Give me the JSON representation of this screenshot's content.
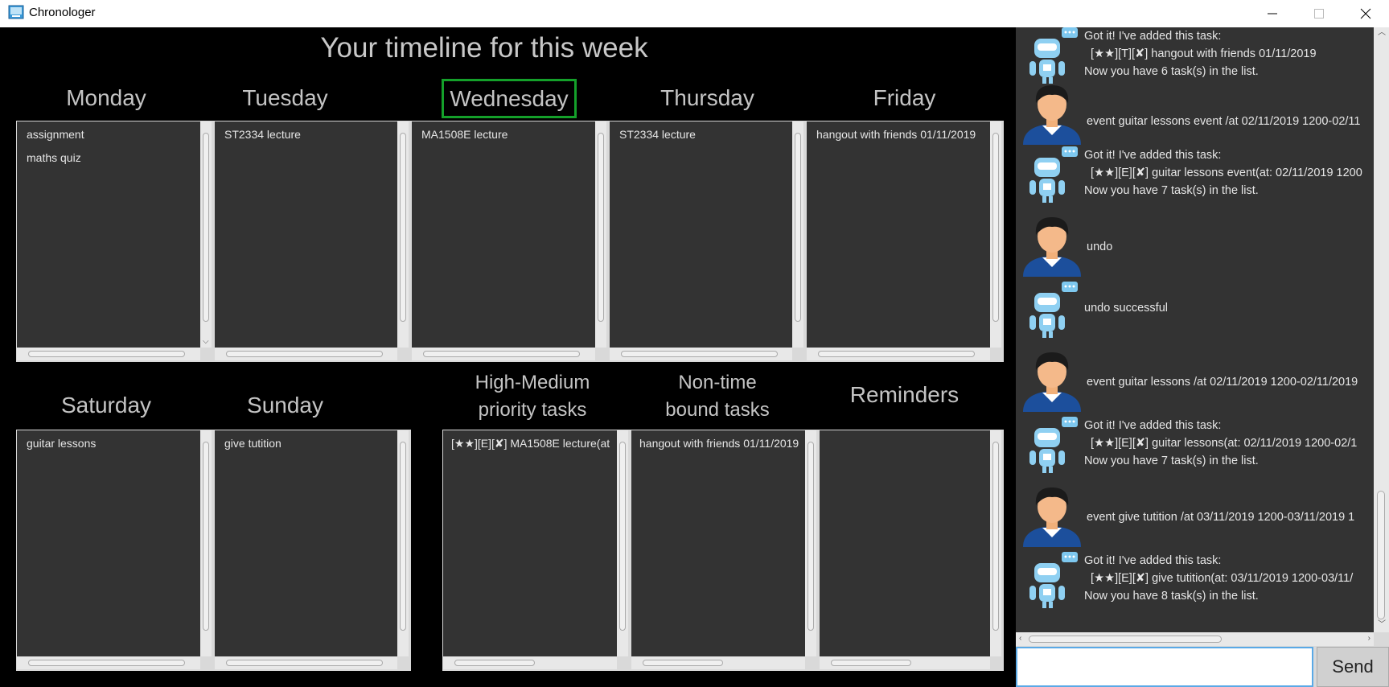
{
  "window": {
    "title": "Chronologer"
  },
  "timeline": {
    "title": "Your timeline for this week"
  },
  "days": [
    {
      "name": "Monday",
      "items": [
        "assignment",
        "maths quiz"
      ]
    },
    {
      "name": "Tuesday",
      "items": [
        "ST2334 lecture"
      ]
    },
    {
      "name": "Wednesday",
      "items": [
        "MA1508E lecture"
      ]
    },
    {
      "name": "Thursday",
      "items": [
        "ST2334 lecture"
      ]
    },
    {
      "name": "Friday",
      "items": [
        "hangout with friends 01/11/2019"
      ]
    },
    {
      "name": "Saturday",
      "items": [
        "guitar lessons"
      ]
    },
    {
      "name": "Sunday",
      "items": [
        "give tutition"
      ]
    }
  ],
  "priority": {
    "label_line1": "High-Medium",
    "label_line2": "priority tasks",
    "items": [
      "[★★][E][✘] MA1508E lecture(at"
    ]
  },
  "nontime": {
    "label_line1": "Non-time",
    "label_line2": "bound tasks",
    "items": [
      "hangout with friends 01/11/2019"
    ]
  },
  "reminders": {
    "label": "Reminders",
    "items": []
  },
  "chat": {
    "messages": [
      {
        "from": "bot",
        "text": "Got it! I've added this task:\n  [★★][T][✘] hangout with friends 01/11/2019\nNow you have 6 task(s) in the list."
      },
      {
        "from": "user",
        "text": "event guitar lessons event /at 02/11/2019 1200-02/11"
      },
      {
        "from": "bot",
        "text": "Got it! I've added this task:\n  [★★][E][✘] guitar lessons event(at: 02/11/2019 1200\nNow you have 7 task(s) in the list."
      },
      {
        "from": "user",
        "text": "undo"
      },
      {
        "from": "bot",
        "text": "undo successful"
      },
      {
        "from": "user",
        "text": "event guitar lessons /at 02/11/2019 1200-02/11/2019"
      },
      {
        "from": "bot",
        "text": "Got it! I've added this task:\n  [★★][E][✘] guitar lessons(at: 02/11/2019 1200-02/1\nNow you have 7 task(s) in the list."
      },
      {
        "from": "user",
        "text": "event give tutition /at 03/11/2019 1200-03/11/2019 1"
      },
      {
        "from": "bot",
        "text": "Got it! I've added this task:\n  [★★][E][✘] give tutition(at: 03/11/2019 1200-03/11/\nNow you have 8 task(s) in the list."
      }
    ],
    "input_value": "",
    "send_label": "Send"
  },
  "colors": {
    "today_highlight": "#14a02a",
    "panel_bg": "#333333",
    "window_bg": "#000000"
  }
}
